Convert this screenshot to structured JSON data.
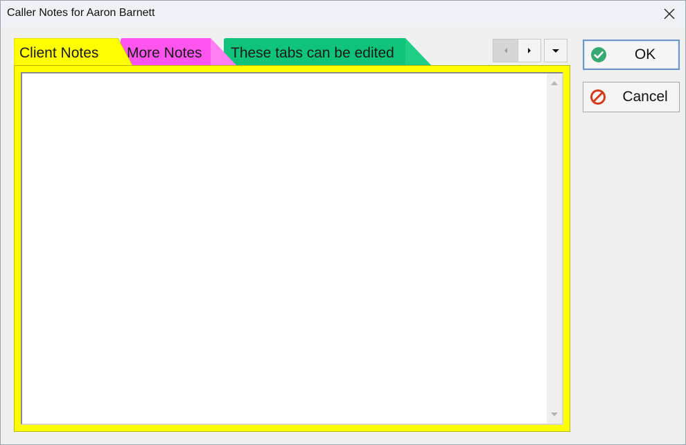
{
  "window": {
    "title": "Caller Notes for Aaron Barnett",
    "close_icon": "close-icon"
  },
  "tabs": [
    {
      "label": "Client Notes",
      "color": "#ffff00",
      "selected": true
    },
    {
      "label": "More Notes",
      "color": "#ff55ee",
      "selected": false
    },
    {
      "label": "These tabs can be edited",
      "color": "#0fc37a",
      "selected": false
    }
  ],
  "tab_nav": {
    "prev_icon": "chevron-left-icon",
    "next_icon": "chevron-right-icon",
    "menu_icon": "chevron-down-icon"
  },
  "notes": {
    "value": ""
  },
  "buttons": {
    "ok_label": "OK",
    "ok_icon": "check-circle-icon",
    "cancel_label": "Cancel",
    "cancel_icon": "no-entry-icon"
  },
  "colors": {
    "panel": "#ffff00",
    "ok_icon": "#3aa873",
    "cancel_icon": "#d33a1d"
  }
}
